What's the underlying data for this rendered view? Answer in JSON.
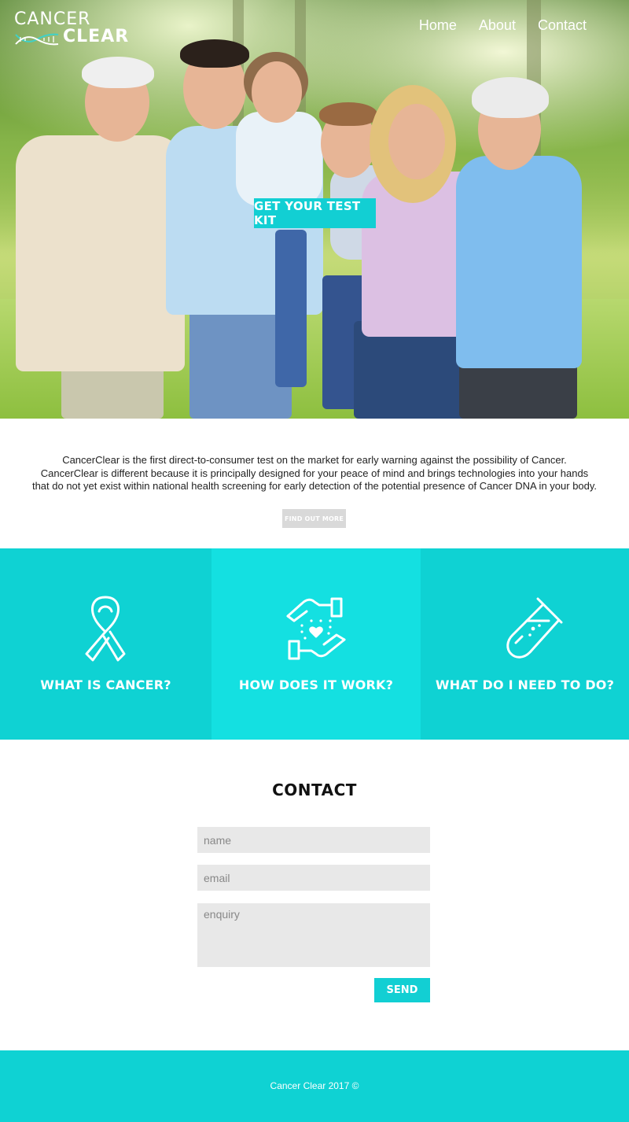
{
  "brand": {
    "line1": "CANCER",
    "line2": "CLEAR",
    "logo_icon": "dna-icon"
  },
  "nav": {
    "items": [
      {
        "label": "Home"
      },
      {
        "label": "About"
      },
      {
        "label": "Contact"
      }
    ]
  },
  "hero": {
    "cta_label": "GET YOUR TEST KIT",
    "image": "family-photo"
  },
  "intro": {
    "lines": [
      "CancerClear is the first direct-to-consumer test on the market for early warning against the possibility of Cancer.",
      "CancerClear is different because it is principally designed for your peace of mind and brings technologies into your hands",
      "that do not yet exist within national health screening for early detection of the potential presence of Cancer DNA in your body."
    ],
    "button_label": "FIND OUT MORE"
  },
  "features": [
    {
      "title": "WHAT IS CANCER?",
      "icon": "ribbon-icon"
    },
    {
      "title": "HOW DOES IT WORK?",
      "icon": "hands-heart-icon"
    },
    {
      "title": "WHAT DO I NEED TO DO?",
      "icon": "test-tube-icon"
    }
  ],
  "contact": {
    "title": "CONTACT",
    "name_placeholder": "name",
    "email_placeholder": "email",
    "enquiry_placeholder": "enquiry",
    "send_label": "SEND"
  },
  "footer": {
    "text": "Cancer Clear 2017 ©"
  },
  "colors": {
    "accent": "#12cfd3",
    "feature_alt": "#14e0e1",
    "button_grey": "#d9d9d9",
    "field_bg": "#e8e8e8"
  }
}
